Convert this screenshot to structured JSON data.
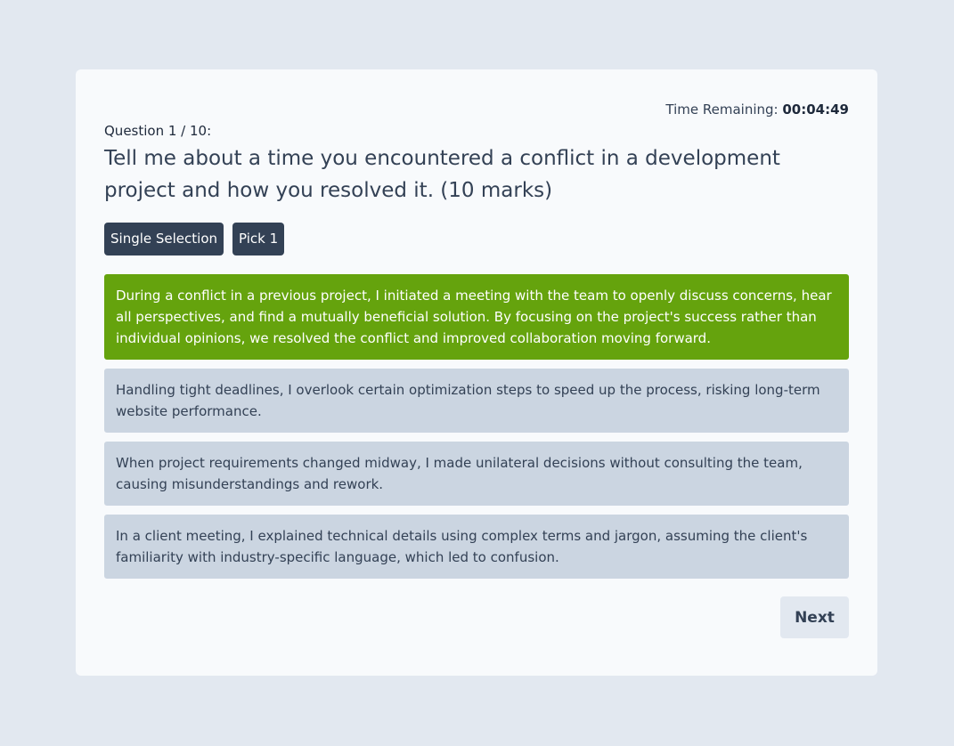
{
  "timer": {
    "label": "Time Remaining:",
    "value": "00:04:49"
  },
  "question": {
    "counter": "Question 1 / 10:",
    "text": "Tell me about a time you encountered a conflict in a development project and how you resolved it. (10 marks)"
  },
  "tags": [
    "Single Selection",
    "Pick 1"
  ],
  "options": [
    {
      "text": "During a conflict in a previous project, I initiated a meeting with the team to openly discuss concerns, hear all perspectives, and find a mutually beneficial solution. By focusing on the project's success rather than individual opinions, we resolved the conflict and improved collaboration moving forward.",
      "selected": true
    },
    {
      "text": "Handling tight deadlines, I overlook certain optimization steps to speed up the process, risking long-term website performance.",
      "selected": false
    },
    {
      "text": "When project requirements changed midway, I made unilateral decisions without consulting the team, causing misunderstandings and rework.",
      "selected": false
    },
    {
      "text": "In a client meeting, I explained technical details using complex terms and jargon, assuming the client's familiarity with industry-specific language, which led to confusion.",
      "selected": false
    }
  ],
  "actions": {
    "next_label": "Next"
  },
  "colors": {
    "background": "#e2e8f0",
    "card": "#f8fafc",
    "tag": "#334155",
    "option_selected": "#65a30d",
    "option_default": "#cbd5e1"
  }
}
